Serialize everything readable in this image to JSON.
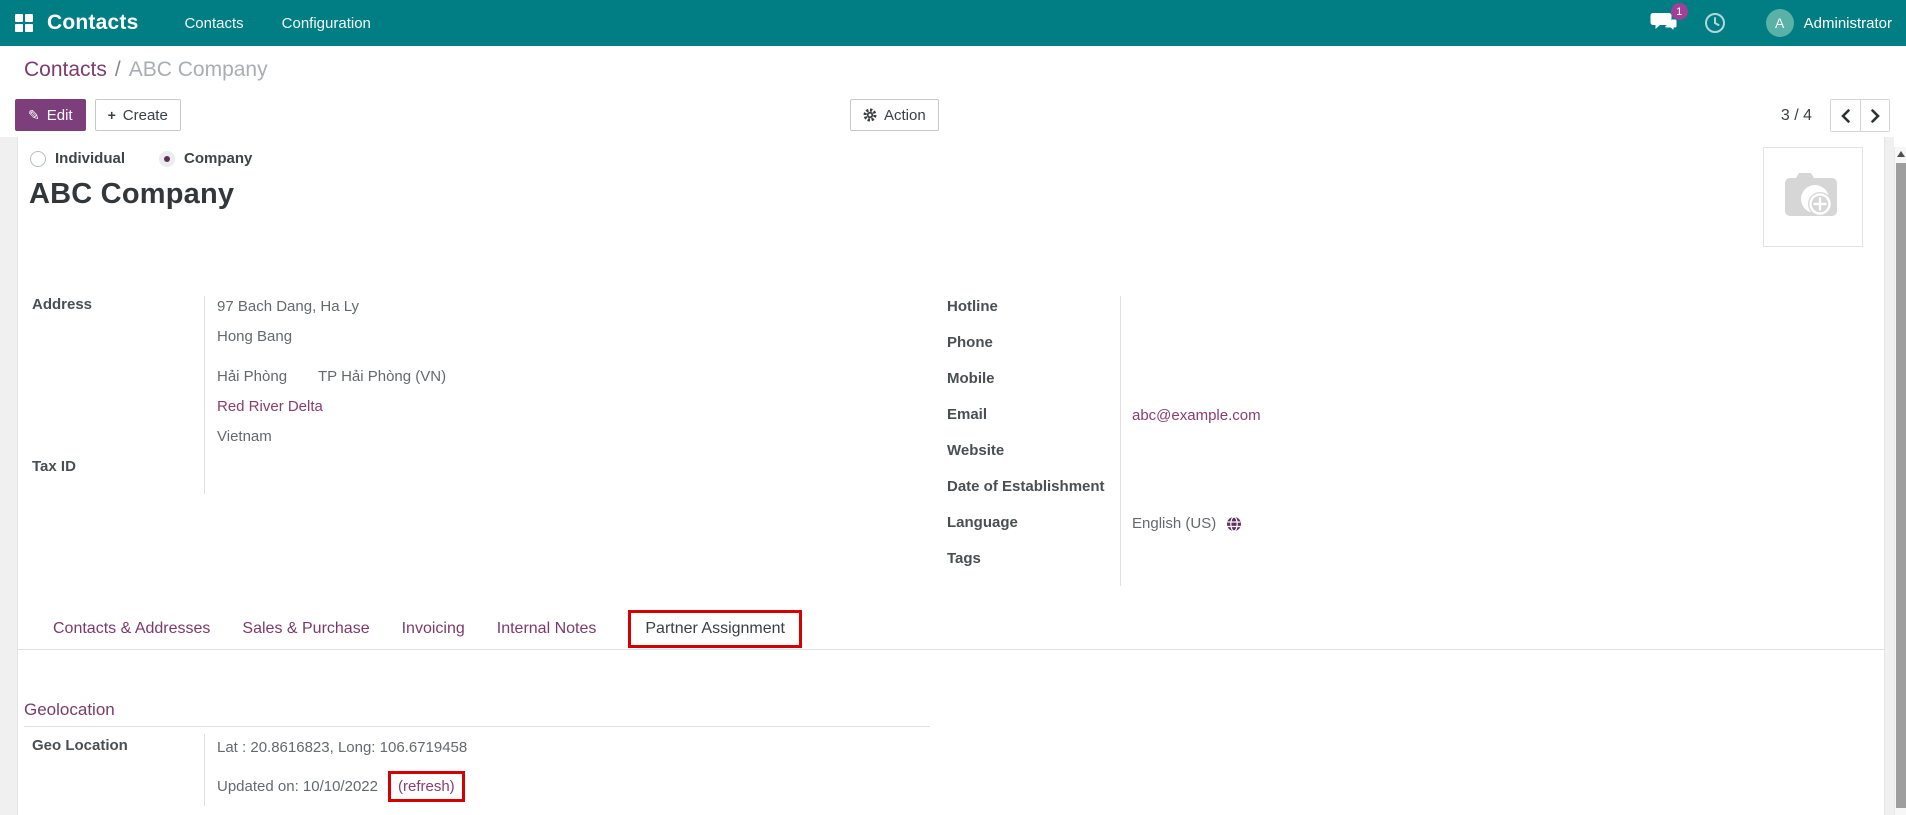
{
  "colors": {
    "topbar_teal": "#017e84",
    "primary_purple": "#7c3f7c",
    "link_purple": "#8a3d6f",
    "badge_magenta": "#a23f97",
    "annotation_red": "#d50000"
  },
  "topbar": {
    "app_name": "Contacts",
    "menu_items": [
      {
        "label": "Contacts"
      },
      {
        "label": "Configuration"
      }
    ],
    "messages_badge": "1",
    "user_initial": "A",
    "user_name": "Administrator"
  },
  "breadcrumb": {
    "parent": "Contacts",
    "separator": "/",
    "current": "ABC Company"
  },
  "control_panel": {
    "edit_label": "Edit",
    "create_label": "Create",
    "action_label": "Action",
    "pager_value": "3 / 4"
  },
  "form": {
    "company_type": {
      "options": [
        {
          "label": "Individual",
          "selected": false
        },
        {
          "label": "Company",
          "selected": true
        }
      ]
    },
    "title": "ABC Company",
    "address": {
      "label": "Address",
      "street": "97 Bach Dang, Ha Ly",
      "street2": "Hong Bang",
      "city": "Hải Phòng",
      "state": "TP Hải Phòng (VN)",
      "region_link": "Red River Delta",
      "country": "Vietnam"
    },
    "tax_id_label": "Tax ID",
    "right_fields": [
      {
        "label": "Hotline",
        "value": ""
      },
      {
        "label": "Phone",
        "value": ""
      },
      {
        "label": "Mobile",
        "value": ""
      },
      {
        "label": "Email",
        "value": "abc@example.com"
      },
      {
        "label": "Website",
        "value": ""
      },
      {
        "label": "Date of Establishment",
        "value": ""
      },
      {
        "label": "Language",
        "value": "English (US)"
      },
      {
        "label": "Tags",
        "value": ""
      }
    ]
  },
  "tabs": [
    {
      "label": "Contacts & Addresses",
      "active": false
    },
    {
      "label": "Sales & Purchase",
      "active": false
    },
    {
      "label": "Invoicing",
      "active": false
    },
    {
      "label": "Internal Notes",
      "active": false
    },
    {
      "label": "Partner Assignment",
      "active": true,
      "annotated": true
    }
  ],
  "geolocation": {
    "section_title": "Geolocation",
    "field_label": "Geo Location",
    "coordinates": "Lat : 20.8616823, Long: 106.6719458",
    "updated_text": "Updated on: 10/10/2022",
    "refresh_label": "(refresh)",
    "refresh_annotated": true
  }
}
